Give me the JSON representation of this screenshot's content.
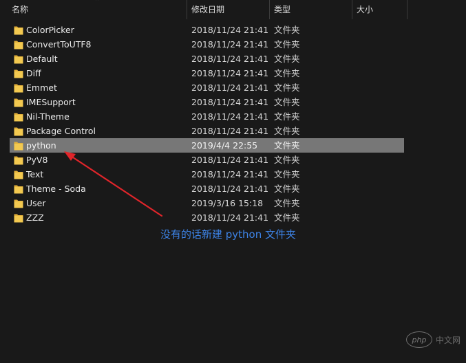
{
  "header": {
    "name_label": "名称",
    "date_label": "修改日期",
    "type_label": "类型",
    "size_label": "大小"
  },
  "rows": [
    {
      "name": "ColorPicker",
      "date": "2018/11/24 21:41",
      "type": "文件夹"
    },
    {
      "name": "ConvertToUTF8",
      "date": "2018/11/24 21:41",
      "type": "文件夹"
    },
    {
      "name": "Default",
      "date": "2018/11/24 21:41",
      "type": "文件夹"
    },
    {
      "name": "Diff",
      "date": "2018/11/24 21:41",
      "type": "文件夹"
    },
    {
      "name": "Emmet",
      "date": "2018/11/24 21:41",
      "type": "文件夹"
    },
    {
      "name": "IMESupport",
      "date": "2018/11/24 21:41",
      "type": "文件夹"
    },
    {
      "name": "Nil-Theme",
      "date": "2018/11/24 21:41",
      "type": "文件夹"
    },
    {
      "name": "Package Control",
      "date": "2018/11/24 21:41",
      "type": "文件夹"
    },
    {
      "name": "python",
      "date": "2019/4/4 22:55",
      "type": "文件夹",
      "selected": true
    },
    {
      "name": "PyV8",
      "date": "2018/11/24 21:41",
      "type": "文件夹"
    },
    {
      "name": "Text",
      "date": "2018/11/24 21:41",
      "type": "文件夹"
    },
    {
      "name": "Theme - Soda",
      "date": "2018/11/24 21:41",
      "type": "文件夹"
    },
    {
      "name": "User",
      "date": "2019/3/16 15:18",
      "type": "文件夹"
    },
    {
      "name": "ZZZ",
      "date": "2018/11/24 21:41",
      "type": "文件夹"
    }
  ],
  "annotation": {
    "text": "没有的话新建 python 文件夹",
    "color": "#3d83e6",
    "arrow_color": "#e0252a"
  },
  "watermark": {
    "badge": "php",
    "text": "中文网"
  },
  "colors": {
    "background": "#191919",
    "selected_row": "#777777",
    "folder": "#f3c950"
  },
  "icons": {
    "folder": "folder-icon",
    "sort": "chevron-up-icon"
  }
}
